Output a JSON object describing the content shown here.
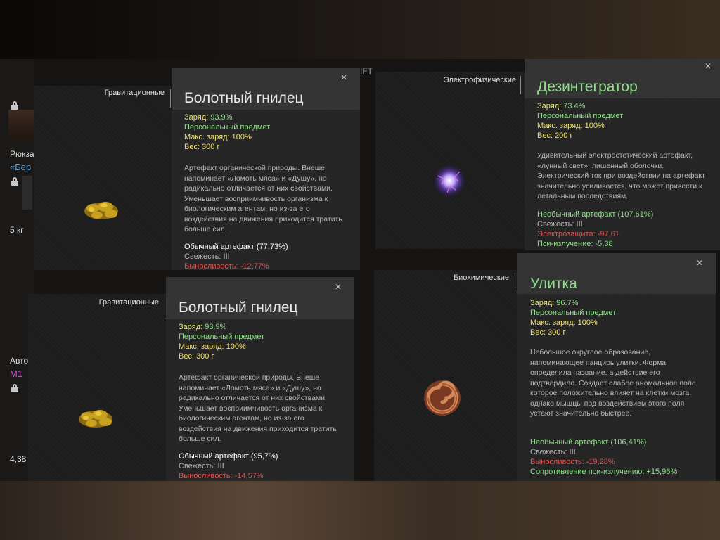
{
  "inventory": {
    "backpack_label": "Рюкза",
    "backpack_name": "«Бер",
    "backpack_weight": "5 кг",
    "weapon_label": "Авто",
    "weapon_name": "М1",
    "weapon_weight": "4,38",
    "fragment": "IFT"
  },
  "cards": [
    {
      "category": "Гравитационные",
      "title": "Болотный гнилец",
      "charge_label": "Заряд:",
      "charge_value": "93.9%",
      "personal": "Персональный предмет",
      "max_charge": "Макс. заряд: 100%",
      "weight": "Вес: 300 г",
      "description": "Артефакт органической природы. Внеше напоминает «Ломоть мяса» и «Душу», но радикально отличается от них свойствами. Уменьшает восприимчивость организма к биологическим агентам, но из-за его воздействия на движения приходится тратить больше сил.",
      "rarity": "Обычный артефакт (77,73%)",
      "freshness": "Свежесть: III",
      "stat1": "Выносливость: -12,77%",
      "stat2": "",
      "artifact_icon": "swamp-rot-artifact"
    },
    {
      "category": "Электрофизические",
      "title": "Дезинтегратор",
      "charge_label": "Заряд:",
      "charge_value": "73.4%",
      "personal": "Персональный предмет",
      "max_charge": "Макс. заряд: 100%",
      "weight": "Вес: 200 г",
      "description": "Удивительный электростетический артефакт, «лунный свет», лишенный оболочки. Электрический ток при воздействии на артефакт значительно усиливается, что может привести к летальным последствиям.",
      "rarity": "Необычный артефакт (107,61%)",
      "freshness": "Свежесть: III",
      "stat1": "Электрозащита: -97,61",
      "stat2": "Пси-излучение: -5,38",
      "artifact_icon": "disintegrator-artifact"
    },
    {
      "category": "Гравитационные",
      "title": "Болотный гнилец",
      "charge_label": "Заряд:",
      "charge_value": "93.9%",
      "personal": "Персональный предмет",
      "max_charge": "Макс. заряд: 100%",
      "weight": "Вес: 300 г",
      "description": "Артефакт органической природы. Внеше напоминает «Ломоть мяса» и «Душу», но радикально отличается от них свойствами. Уменьшает восприимчивость организма к биологическим агентам, но из-за его воздействия на движения приходится тратить больше сил.",
      "rarity": "Обычный артефакт (95,7%)",
      "freshness": "Свежесть: III",
      "stat1": "Выносливость: -14,57%",
      "stat2": "",
      "artifact_icon": "swamp-rot-artifact"
    },
    {
      "category": "Биохимические",
      "title": "Улитка",
      "charge_label": "Заряд:",
      "charge_value": "96.7%",
      "personal": "Персональный предмет",
      "max_charge": "Макс. заряд: 100%",
      "weight": "Вес: 300 г",
      "description": "Небольшое округлое образование, напоминающее панцирь улитки. Форма определила название, а действие его подтвердило. Создает слабое аномальное поле, которое положительно влияет на клетки мозга, однако мыщцы под воздействием этого поля устают значительно быстрее.",
      "rarity": "Необычный артефакт (106,41%)",
      "freshness": "Свежесть: III",
      "stat1": "Выносливость: -19,28%",
      "stat2": "Сопротивление пси-излучению: +15,96%",
      "artifact_icon": "snail-artifact"
    }
  ],
  "colors": {
    "title_green": "#8ee088",
    "label_yellow": "#e6e66a",
    "negative_red": "#e05050",
    "positive_green": "#8ee088"
  },
  "close_glyph": "×"
}
